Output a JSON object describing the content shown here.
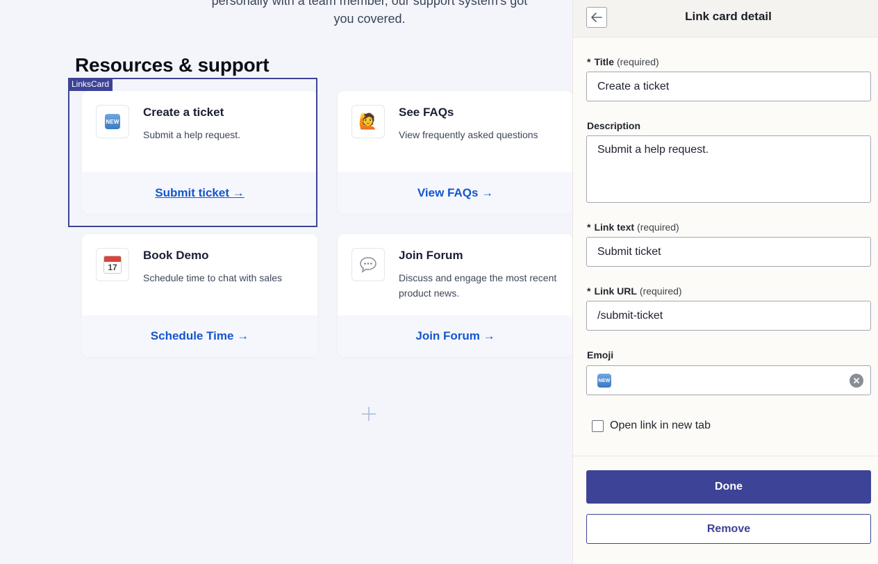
{
  "canvas": {
    "intro_line1": "personally with a team member, our support system's got",
    "intro_line2": "you covered.",
    "section_title": "Resources & support",
    "selection_tag": "LinksCard",
    "cards": [
      {
        "emoji": "new-button-icon",
        "emoji_text": "NEW",
        "title": "Create a ticket",
        "description": "Submit a help request.",
        "link": "Submit ticket →"
      },
      {
        "emoji": "person-raising-hand-icon",
        "emoji_text": "🙋",
        "title": "See FAQs",
        "description": "View frequently asked questions",
        "link": "View FAQs →"
      },
      {
        "emoji": "calendar-icon",
        "emoji_text": "17",
        "title": "Book Demo",
        "description": "Schedule time to chat with sales",
        "link": "Schedule Time →"
      },
      {
        "emoji": "speech-bubble-icon",
        "emoji_text": "",
        "title": "Join Forum",
        "description": "Discuss and engage the most recent product news.",
        "link": "Join Forum →"
      }
    ]
  },
  "panel": {
    "title": "Link card detail",
    "fields": {
      "title": {
        "label": "Title",
        "note": "(required)",
        "value": "Create a ticket"
      },
      "description": {
        "label": "Description",
        "value": "Submit a help request."
      },
      "link_text": {
        "label": "Link text",
        "note": "(required)",
        "value": "Submit ticket"
      },
      "link_url": {
        "label": "Link URL",
        "note": "(required)",
        "value": "/submit-ticket"
      },
      "emoji": {
        "label": "Emoji",
        "value": "NEW"
      }
    },
    "required_star": "*",
    "open_new_tab_label": "Open link in new tab",
    "done_label": "Done",
    "remove_label": "Remove"
  },
  "colors": {
    "accent": "#3d4396",
    "link": "#1356d0",
    "canvas_bg": "#f4f5fa",
    "panel_bg": "#fcfbf7"
  }
}
